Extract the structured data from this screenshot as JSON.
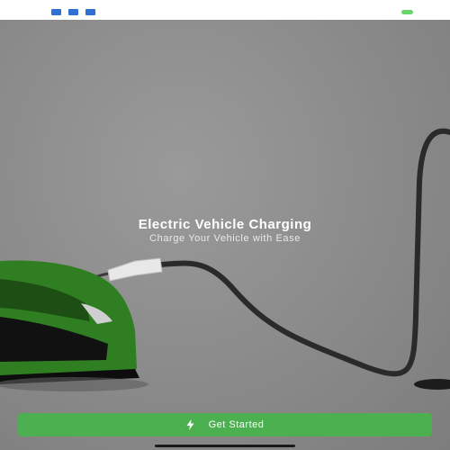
{
  "status_bar": {
    "icons": [
      "app-notification-icon",
      "app-notification-icon",
      "app-notification-icon"
    ],
    "battery_icon": "battery-icon"
  },
  "hero": {
    "image": "electric-car-charging-cable",
    "title": "Electric Vehicle Charging",
    "subtitle": "Charge Your Vehicle with Ease"
  },
  "cta": {
    "label": "Get Started",
    "icon": "lightning-bolt-icon"
  },
  "colors": {
    "accent": "#4caf50",
    "car": "#2e7d24",
    "background": "#8a8a8a"
  }
}
